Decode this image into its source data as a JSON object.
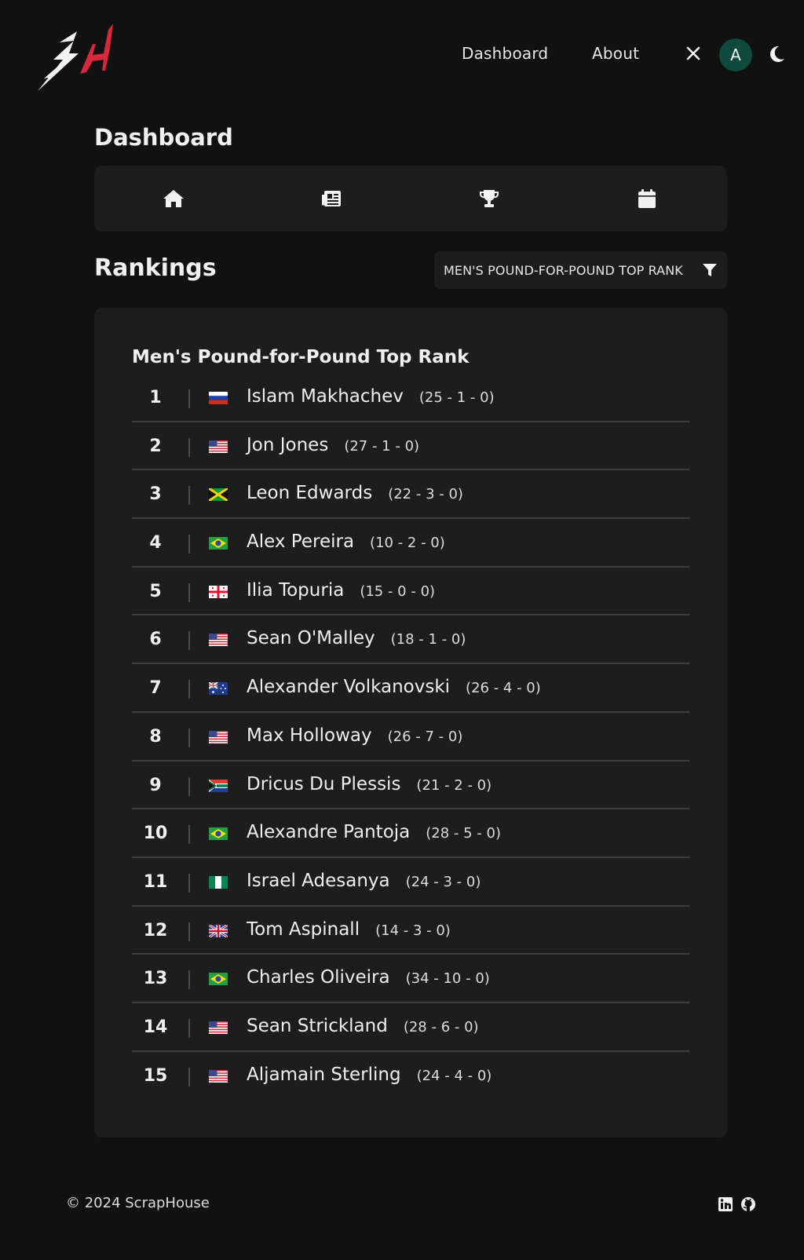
{
  "header": {
    "nav": {
      "dashboard": "Dashboard",
      "about": "About"
    },
    "avatar_letter": "A",
    "icons": [
      "logo",
      "close-icon",
      "moon-icon"
    ],
    "colors": {
      "logo_white": "#f2f2f2",
      "logo_red": "#d8283c",
      "avatar_bg": "#0f4b3c"
    }
  },
  "dashboard": {
    "title": "Dashboard",
    "icons": [
      "home-icon",
      "newspaper-icon",
      "trophy-icon",
      "calendar-icon"
    ]
  },
  "rankings": {
    "title": "Rankings",
    "filter_label": "MEN'S POUND-FOR-POUND TOP RANK",
    "filter_icon": "filter-icon",
    "card_title": "Men's Pound-for-Pound Top Rank",
    "fighters": [
      {
        "rank": "1",
        "flag": "russia",
        "name": "Islam Makhachev",
        "record": "(25 - 1 - 0)"
      },
      {
        "rank": "2",
        "flag": "usa",
        "name": "Jon Jones",
        "record": "(27 - 1 - 0)"
      },
      {
        "rank": "3",
        "flag": "jamaica",
        "name": "Leon Edwards",
        "record": "(22 - 3 - 0)"
      },
      {
        "rank": "4",
        "flag": "brazil",
        "name": "Alex Pereira",
        "record": "(10 - 2 - 0)"
      },
      {
        "rank": "5",
        "flag": "georgia",
        "name": "Ilia Topuria",
        "record": "(15 - 0 - 0)"
      },
      {
        "rank": "6",
        "flag": "usa",
        "name": "Sean O'Malley",
        "record": "(18 - 1 - 0)"
      },
      {
        "rank": "7",
        "flag": "australia",
        "name": "Alexander Volkanovski",
        "record": "(26 - 4 - 0)"
      },
      {
        "rank": "8",
        "flag": "usa",
        "name": "Max Holloway",
        "record": "(26 - 7 - 0)"
      },
      {
        "rank": "9",
        "flag": "south-africa",
        "name": "Dricus Du Plessis",
        "record": "(21 - 2 - 0)"
      },
      {
        "rank": "10",
        "flag": "brazil",
        "name": "Alexandre Pantoja",
        "record": "(28 - 5 - 0)"
      },
      {
        "rank": "11",
        "flag": "nigeria",
        "name": "Israel Adesanya",
        "record": "(24 - 3 - 0)"
      },
      {
        "rank": "12",
        "flag": "uk",
        "name": "Tom Aspinall",
        "record": "(14 - 3 - 0)"
      },
      {
        "rank": "13",
        "flag": "brazil",
        "name": "Charles Oliveira",
        "record": "(34 - 10 - 0)"
      },
      {
        "rank": "14",
        "flag": "usa",
        "name": "Sean Strickland",
        "record": "(28 - 6 - 0)"
      },
      {
        "rank": "15",
        "flag": "usa",
        "name": "Aljamain Sterling",
        "record": "(24 - 4 - 0)"
      }
    ]
  },
  "footer": {
    "copyright": "© 2024 ScrapHouse",
    "icons": [
      "linkedin-icon",
      "github-icon"
    ]
  }
}
